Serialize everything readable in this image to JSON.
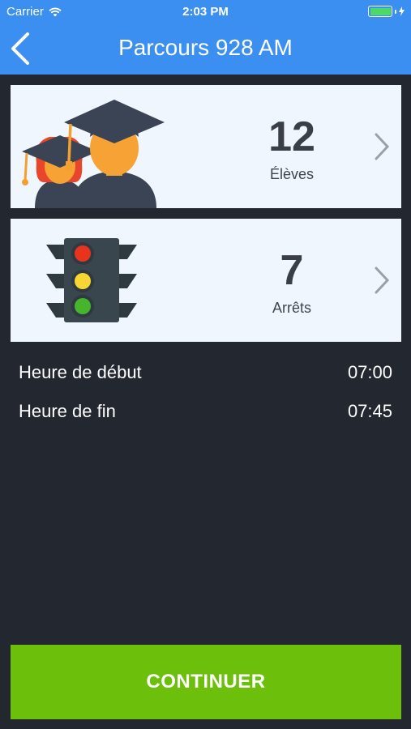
{
  "status_bar": {
    "carrier": "Carrier",
    "time": "2:03 PM",
    "wifi_icon": "wifi-icon",
    "battery_icon": "battery-icon",
    "battery_level": 1.0
  },
  "nav": {
    "title": "Parcours 928 AM",
    "back_icon": "chevron-left-icon",
    "color": "#3a8ff0"
  },
  "cards": [
    {
      "count": "12",
      "label": "Élèves",
      "icon": "graduates-icon"
    },
    {
      "count": "7",
      "label": "Arrêts",
      "icon": "traffic-light-icon"
    }
  ],
  "schedule": {
    "start_label": "Heure de début",
    "start_value": "07:00",
    "end_label": "Heure de fin",
    "end_value": "07:45"
  },
  "continue_button": {
    "label": "CONTINUER",
    "color": "#6cbf0b"
  },
  "background_color": "#232730"
}
